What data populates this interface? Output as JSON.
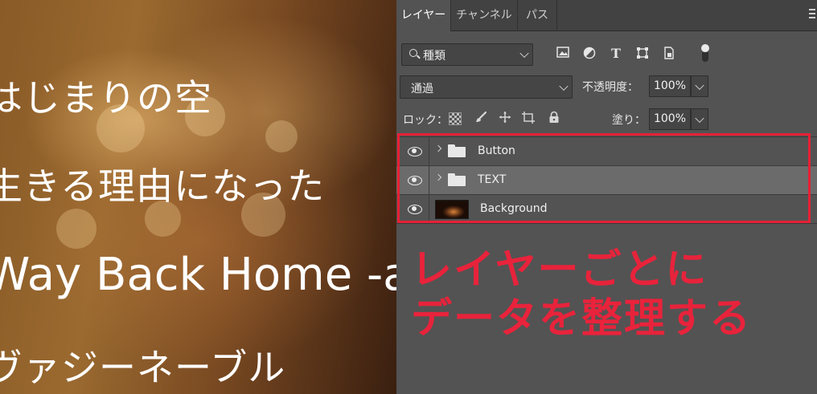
{
  "canvas": {
    "lines": [
      "はじまりの空",
      "生きる理由になった",
      "Way Back Home -ac",
      "ヴァジーネーブル"
    ]
  },
  "panel": {
    "tabs": [
      "レイヤー",
      "チャンネル",
      "パス"
    ],
    "active_tab": "レイヤー",
    "filter": {
      "kind_label": "種類",
      "icons": [
        "image-filter-icon",
        "adjustment-filter-icon",
        "text-filter-icon",
        "shape-filter-icon",
        "smart-object-filter-icon",
        "filter-toggle-icon"
      ]
    },
    "blend_mode": "通過",
    "opacity_label": "不透明度：",
    "opacity_value": "100%",
    "lock_label": "ロック：",
    "lock_icons": [
      "lock-transparent-pixels-icon",
      "lock-image-pixels-icon",
      "lock-position-icon",
      "lock-artboard-icon",
      "lock-all-icon"
    ],
    "fill_label": "塗り：",
    "fill_value": "100%",
    "layers": [
      {
        "name": "Button",
        "type": "group",
        "visible": true,
        "selected": false
      },
      {
        "name": "TEXT",
        "type": "group",
        "visible": true,
        "selected": true
      },
      {
        "name": "Background",
        "type": "image",
        "visible": true,
        "selected": false
      }
    ]
  },
  "annotation": {
    "line1": "レイヤーごとに",
    "line2": "データを整理する",
    "color": "#e8233b"
  },
  "colors": {
    "panel_bg": "#535353",
    "selected_layer_bg": "#6b6b6b",
    "highlight_border": "#e62036"
  }
}
